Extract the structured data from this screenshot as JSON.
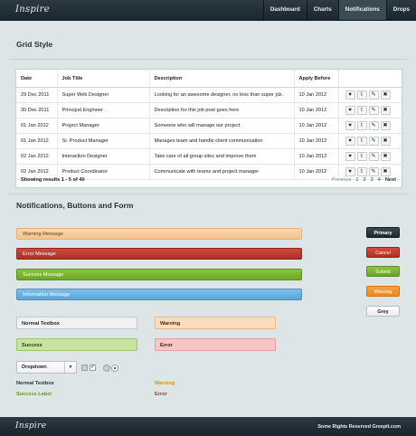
{
  "header": {
    "logo": "Inspire",
    "nav": [
      "Dashboard",
      "Charts",
      "Notifications",
      "Drops"
    ],
    "active_nav": "Notifications"
  },
  "grid": {
    "title": "Grid Style",
    "columns": [
      "Date",
      "Job Title",
      "Description",
      "Apply Before"
    ],
    "rows": [
      {
        "date": "29 Dec 2011",
        "job": "Super Web Designer",
        "desc": "Looking for an awesome designer, no less than super plz.",
        "apply": "10 Jan 2012"
      },
      {
        "date": "30 Dec 2011",
        "job": "Principal Engineer",
        "desc": "Description for this job post goes here",
        "apply": "10 Jan 2012"
      },
      {
        "date": "01 Jan 2012",
        "job": "Project Manager",
        "desc": "Someone who will manage our project",
        "apply": "10 Jan 2012"
      },
      {
        "date": "01 Jan 2012",
        "job": "Sr. Product Manager",
        "desc": "Manages team and handle client communication",
        "apply": "10 Jan 2012"
      },
      {
        "date": "02 Jan 2012",
        "job": "Interaction Designer",
        "desc": "Take care of all group sites and improve them",
        "apply": "10 Jan 2012"
      },
      {
        "date": "02 Jan 2012",
        "job": "Product Coordinator",
        "desc": "Communicate with teams and project manager",
        "apply": "10 Jan 2012"
      }
    ],
    "row_actions": [
      "heart-icon",
      "twitter-icon",
      "edit-icon",
      "delete-icon"
    ],
    "showing": "Showing results 1 - 5 of 40",
    "pager": {
      "prev": "Previous",
      "pages": [
        "1",
        "2",
        "3",
        "4"
      ],
      "next": "Next"
    }
  },
  "notifications": {
    "title": "Notifications, Buttons and Form",
    "messages": {
      "warning": "Warning Message",
      "error": "Error Message",
      "success": "Success Message",
      "info": "Information Message"
    },
    "buttons": {
      "primary": "Primary",
      "cancel": "Cancel",
      "submit": "Submit",
      "warning": "Warning",
      "grey": "Grey"
    },
    "fields": {
      "normal": "Normal Textbox",
      "warning": "Warning",
      "success": "Success",
      "error": "Error"
    },
    "dropdown": "Dropdown",
    "labels": {
      "normal": "Normal Textbox",
      "success": "Success Label",
      "warning": "Warning",
      "error": "Error"
    }
  },
  "footer": {
    "logo": "Inspire",
    "copyright": "Some Rights Reserved Greepit.com"
  },
  "colors": {
    "header_bg": "#1f2c33",
    "page_bg": "#dde5e6",
    "warning": "#f4c28d",
    "error": "#b23628",
    "success": "#79b532",
    "info": "#68b2e4",
    "orange": "#f29a2a"
  }
}
